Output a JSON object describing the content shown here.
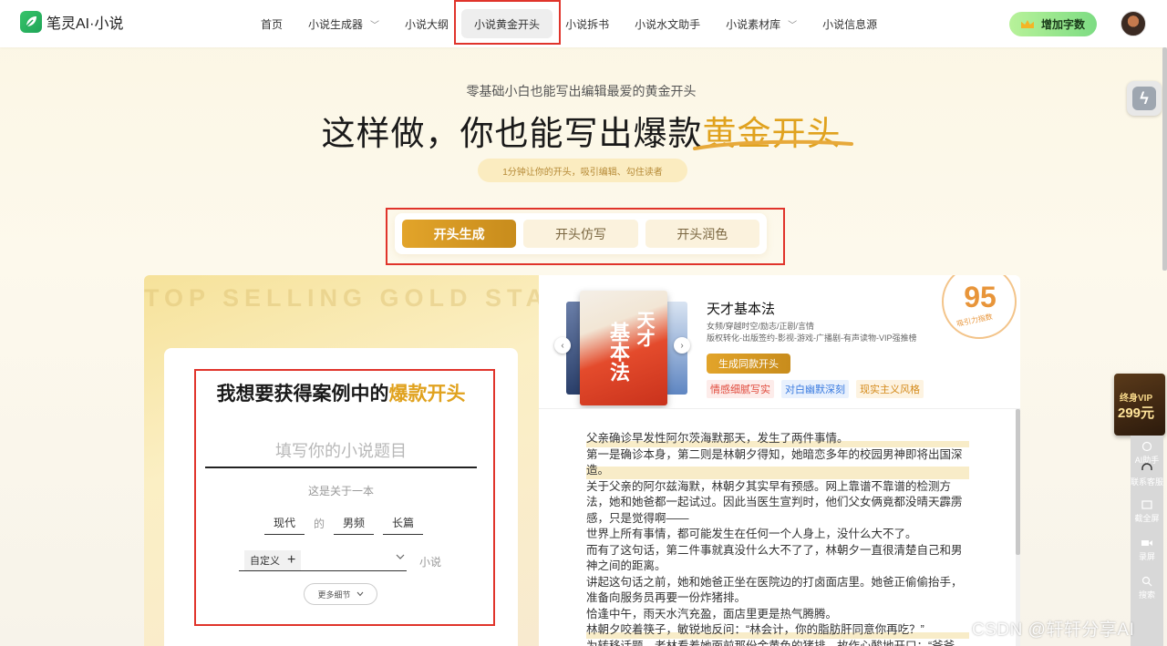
{
  "app": {
    "name": "笔灵AI·小说"
  },
  "nav": {
    "items": [
      {
        "label": "首页",
        "has_dropdown": false
      },
      {
        "label": "小说生成器",
        "has_dropdown": true
      },
      {
        "label": "小说大纲",
        "has_dropdown": false
      },
      {
        "label": "小说黄金开头",
        "has_dropdown": false,
        "active": true
      },
      {
        "label": "小说拆书",
        "has_dropdown": false
      },
      {
        "label": "小说水文助手",
        "has_dropdown": false
      },
      {
        "label": "小说素材库",
        "has_dropdown": true
      },
      {
        "label": "小说信息源",
        "has_dropdown": false
      }
    ],
    "add_words_label": "增加字数"
  },
  "hero": {
    "subtitle": "零基础小白也能写出编辑最爱的黄金开头",
    "title_plain": "这样做，你也能写出爆款",
    "title_highlight": "黄金开头",
    "tagline": "1分钟让你的开头，吸引编辑、勾住读者"
  },
  "modes": {
    "tabs": [
      {
        "label": "开头生成",
        "active": true
      },
      {
        "label": "开头仿写",
        "active": false
      },
      {
        "label": "开头润色",
        "active": false
      }
    ]
  },
  "form": {
    "watermark": "TOP SELLING GOLD START",
    "title_plain": "我想要获得案例中的",
    "title_highlight": "爆款开头",
    "title_placeholder": "填写你的小说题目",
    "about_label": "这是关于一本",
    "era": "现代",
    "of_label": "的",
    "audience": "男频",
    "length": "长篇",
    "genre_chip": "自定义",
    "novel_label": "小说",
    "more_label": "更多细节"
  },
  "example": {
    "book_title": "天才基本法",
    "cover_title_1": "天才",
    "cover_title_2": "基本法",
    "tags_line1": "女频/穿越时空/励志/正剧/言情",
    "tags_line2": "版权转化-出版签约-影视-游戏-广播剧-有声读物-VIP强推榜",
    "generate_label": "生成同款开头",
    "style_tags": [
      {
        "label": "情感细腻写实",
        "color": "#e0483a",
        "bg": "#fdecea"
      },
      {
        "label": "对白幽默深刻",
        "color": "#3a7be0",
        "bg": "#e9f1fd"
      },
      {
        "label": "现实主义风格",
        "color": "#d48a1a",
        "bg": "#fdf3e1"
      }
    ],
    "score": "95",
    "score_label": "吸引力指数",
    "paragraphs": [
      {
        "text": "父亲确诊早发性阿尔茨海默那天，发生了两件事情。",
        "highlight": true
      },
      {
        "text": "第一是确诊本身，第二则是林朝夕得知，她暗恋多年的校园男神即将出国深造。",
        "highlight": true
      },
      {
        "text": "关于父亲的阿尔兹海默，林朝夕其实早有预感。网上靠谱不靠谱的检测方法，她和她爸都一起试过。因此当医生宣判时，他们父女俩竟都没晴天霹雳感，只是觉得啊——",
        "highlight": false
      },
      {
        "text": "世界上所有事情，都可能发生在任何一个人身上，没什么大不了。",
        "highlight": false
      },
      {
        "text": "而有了这句话，第二件事就真没什么大不了了，林朝夕一直很清楚自己和男神之间的距离。",
        "highlight": false
      },
      {
        "text": "讲起这句话之前，她和她爸正坐在医院边的打卤面店里。她爸正偷偷抬手，准备向服务员再要一份炸猪排。",
        "highlight": false
      },
      {
        "text": "恰逢中午，雨天水汽充盈，面店里更是热气腾腾。",
        "highlight": false
      },
      {
        "text": "林朝夕咬着筷子，敏锐地反问：“林会计，你的脂肪肝同意你再吃？”",
        "highlight": true
      },
      {
        "text": "为转移话题，老林看着她面前那份金黄色的猪排，故作心酸地开口：“爷爷",
        "highlight": false
      }
    ]
  },
  "side": {
    "vip_line1": "终身VIP",
    "vip_line2": "299元",
    "tools": [
      {
        "label": "AI助手"
      },
      {
        "label": "联系客服"
      },
      {
        "label": "截全屏"
      },
      {
        "label": "录屏"
      },
      {
        "label": "搜索"
      }
    ]
  },
  "watermark_csdn": "CSDN @轩轩分享AI",
  "colors": {
    "gold": "#e0a21e",
    "brand_green": "#37c46a",
    "annotation_red": "#e0342b"
  }
}
